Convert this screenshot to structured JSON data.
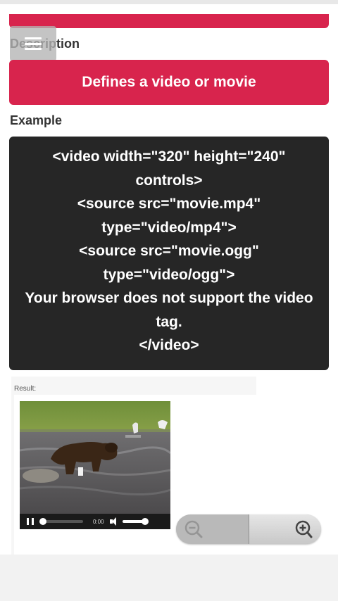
{
  "description_label": "Description",
  "description_text": "Defines a video or movie",
  "example_label": "Example",
  "code_lines": [
    "<video width=\"320\" height=\"240\"",
    "controls>",
    "<source src=\"movie.mp4\"",
    "type=\"video/mp4\">",
    "<source src=\"movie.ogg\"",
    "type=\"video/ogg\">",
    "Your browser does not support the video",
    "tag.",
    "</video>"
  ],
  "result_label": "Result:",
  "video_player": {
    "time": "0:00",
    "progress": 0
  },
  "icons": {
    "menu": "hamburger-menu-icon",
    "zoom_out": "zoom-out-icon",
    "zoom_in": "zoom-in-icon"
  },
  "colors": {
    "accent": "#d8244d",
    "code_bg": "#262626"
  }
}
